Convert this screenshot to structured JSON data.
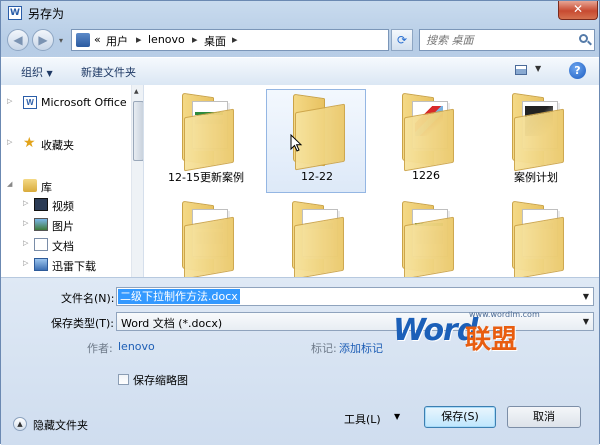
{
  "window": {
    "title": "另存为",
    "close": "✕",
    "app_icon": "W"
  },
  "address": {
    "crumbs": [
      "«",
      "用户",
      "lenovo",
      "桌面"
    ],
    "search_placeholder": "搜索 桌面"
  },
  "toolbar": {
    "organize": "组织",
    "new_folder": "新建文件夹",
    "help": "?"
  },
  "nav": {
    "items": [
      {
        "label": "Microsoft Office",
        "icon": "word-icon"
      },
      {
        "label": "收藏夹",
        "icon": "star-icon"
      },
      {
        "label": "库",
        "icon": "library-icon"
      },
      {
        "label": "视频",
        "icon": "video-icon"
      },
      {
        "label": "图片",
        "icon": "picture-icon"
      },
      {
        "label": "文档",
        "icon": "document-icon"
      },
      {
        "label": "迅雷下载",
        "icon": "thunder-icon"
      }
    ]
  },
  "files": [
    {
      "label": "12-15更新案例",
      "thumb": "excel"
    },
    {
      "label": "12-22",
      "thumb": "empty",
      "selected": true
    },
    {
      "label": "1226",
      "thumb": "photo"
    },
    {
      "label": "案例计划",
      "thumb": "dark"
    },
    {
      "label": "",
      "thumb": "doc"
    },
    {
      "label": "",
      "thumb": "doc"
    },
    {
      "label": "",
      "thumb": "doc"
    },
    {
      "label": "",
      "thumb": "doc"
    }
  ],
  "form": {
    "filename_label": "文件名(N):",
    "filename_value": "二级下拉制作方法.docx",
    "filetype_label": "保存类型(T):",
    "filetype_value": "Word 文档 (*.docx)",
    "author_label": "作者:",
    "author_value": "lenovo",
    "tags_label": "标记:",
    "tags_value": "添加标记",
    "thumbnail_label": "保存缩略图"
  },
  "footer": {
    "hide_folders": "隐藏文件夹",
    "tools": "工具(L)",
    "save": "保存(S)",
    "cancel": "取消"
  },
  "watermark": {
    "word": "Word",
    "cn": "联盟",
    "url": "www.wordlm.com"
  }
}
